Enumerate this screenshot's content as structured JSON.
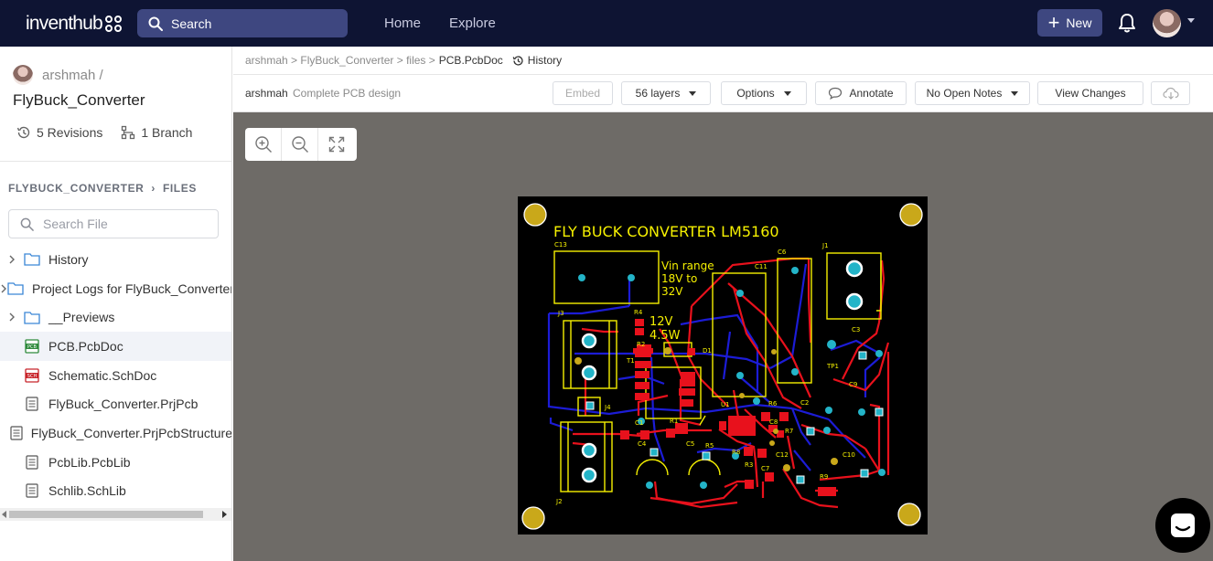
{
  "topbar": {
    "logo_text": "inventhub",
    "search_label": "Search",
    "nav": [
      "Home",
      "Explore"
    ],
    "new_label": "New"
  },
  "sidebar": {
    "owner": "arshmah /",
    "repo": "FlyBuck_Converter",
    "revisions": "5 Revisions",
    "branches": "1 Branch",
    "path_root": "FLYBUCK_CONVERTER",
    "path_sep": "›",
    "path_leaf": "FILES",
    "search_placeholder": "Search File",
    "files": [
      {
        "name": "History",
        "type": "folder"
      },
      {
        "name": "Project Logs for FlyBuck_Converter",
        "type": "folder"
      },
      {
        "name": "__Previews",
        "type": "folder"
      },
      {
        "name": "PCB.PcbDoc",
        "type": "pcb",
        "active": true
      },
      {
        "name": "Schematic.SchDoc",
        "type": "sch"
      },
      {
        "name": "FlyBuck_Converter.PrjPcb",
        "type": "doc"
      },
      {
        "name": "FlyBuck_Converter.PrjPcbStructure",
        "type": "doc"
      },
      {
        "name": "PcbLib.PcbLib",
        "type": "doc"
      },
      {
        "name": "Schlib.SchLib",
        "type": "doc"
      }
    ]
  },
  "breadcrumb": {
    "path": "arshmah > FlyBuck_Converter > files >",
    "current": "PCB.PcbDoc",
    "history": "History"
  },
  "toolbar": {
    "author": "arshmah",
    "description": "Complete PCB design",
    "embed": "Embed",
    "layers": "56 layers",
    "options": "Options",
    "annotate": "Annotate",
    "notes": "No Open Notes",
    "view_changes": "View Changes"
  },
  "pcb": {
    "title": "FLY BUCK CONVERTER LM5160",
    "vin_text_1": "Vin range",
    "vin_text_2": "18V to",
    "vin_text_3": "32V",
    "out_text_1": "12V",
    "out_text_2": "4.5W",
    "labels": [
      "C13",
      "C6",
      "C11",
      "J1",
      "J3",
      "R4",
      "R2",
      "T1",
      "D1",
      "C3",
      "TP1",
      "C9",
      "U1",
      "R6",
      "C8",
      "C2",
      "J4",
      "C1",
      "R1",
      "C4",
      "C5",
      "R5",
      "R7",
      "R8",
      "C12",
      "R3",
      "C7",
      "C10",
      "R9",
      "J2"
    ],
    "colors": {
      "board": "#000000",
      "silk": "#f5f000",
      "top_copper": "#e8111c",
      "bottom_copper": "#1c1cd6",
      "pad": "#c9a81a",
      "via": "#23b4c8"
    }
  }
}
